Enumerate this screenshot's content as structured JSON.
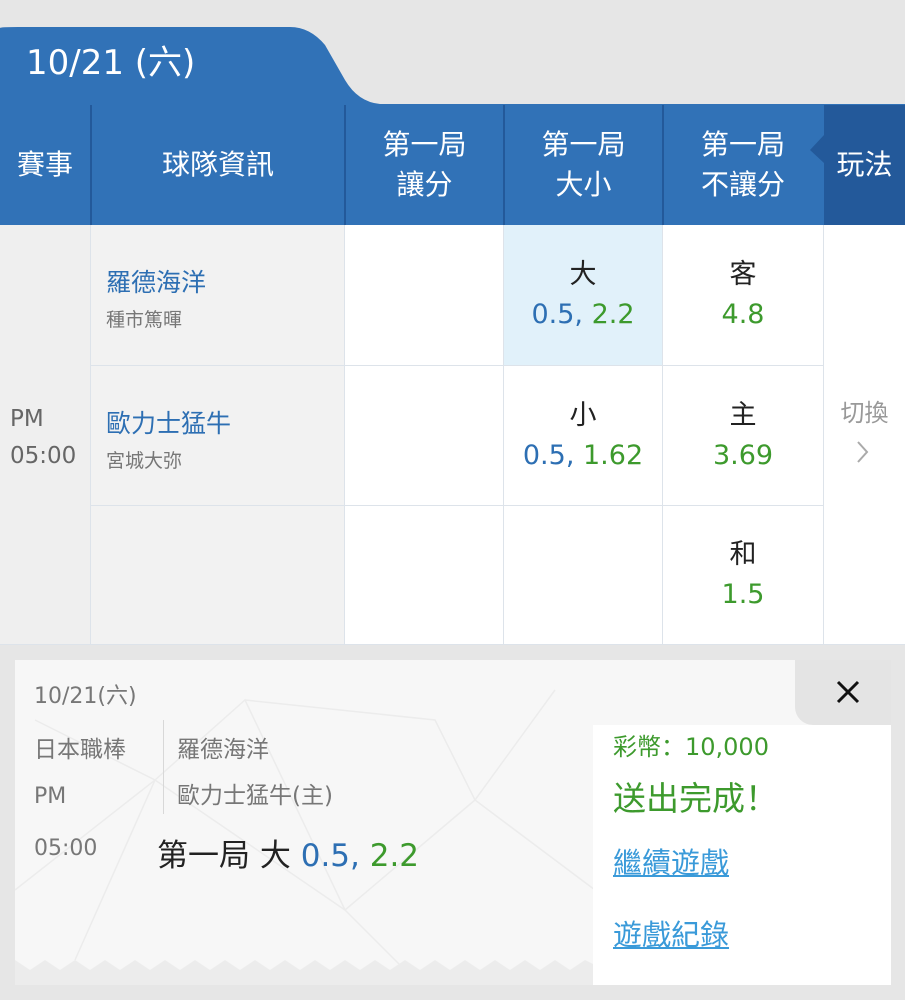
{
  "date": "10/21 (六)",
  "header": {
    "event": "賽事",
    "team_info": "球隊資訊",
    "col_handicap": [
      "第一局",
      "讓分"
    ],
    "col_overunder": [
      "第一局",
      "大小"
    ],
    "col_moneyline": [
      "第一局",
      "不讓分"
    ],
    "play": "玩法"
  },
  "match": {
    "time_ampm": "PM",
    "time": "05:00",
    "away_team": "羅德海洋",
    "away_pitcher": "種市篤暉",
    "home_team": "歐力士猛牛",
    "home_pitcher": "宮城大弥",
    "over": {
      "label": "大",
      "line": "0.5,",
      "odds": "2.2"
    },
    "under": {
      "label": "小",
      "line": "0.5,",
      "odds": "1.62"
    },
    "away_win": {
      "label": "客",
      "odds": "4.8"
    },
    "home_win": {
      "label": "主",
      "odds": "3.69"
    },
    "draw": {
      "label": "和",
      "odds": "1.5"
    },
    "switch_label": "切換",
    "switch_arrow": "chevron-right-icon"
  },
  "slip": {
    "date": "10/21(六)",
    "league": "日本職棒",
    "ampm": "PM",
    "time": "05:00",
    "team1": "羅德海洋",
    "team2": "歐力士猛牛(主)",
    "bet_desc": "第一局 大",
    "bet_line": "0.5,",
    "bet_odds": "2.2",
    "coins": "彩幣：10,000",
    "status": "送出完成！",
    "continue_link": "繼續遊戲",
    "history_link": "遊戲紀錄",
    "close_icon": "close-icon"
  },
  "colors": {
    "header_blue": "#3172b7",
    "dark_blue": "#23599a",
    "odds_blue": "#2d6fb3",
    "odds_green": "#3d9a2d",
    "link_blue": "#3a9ad9"
  }
}
